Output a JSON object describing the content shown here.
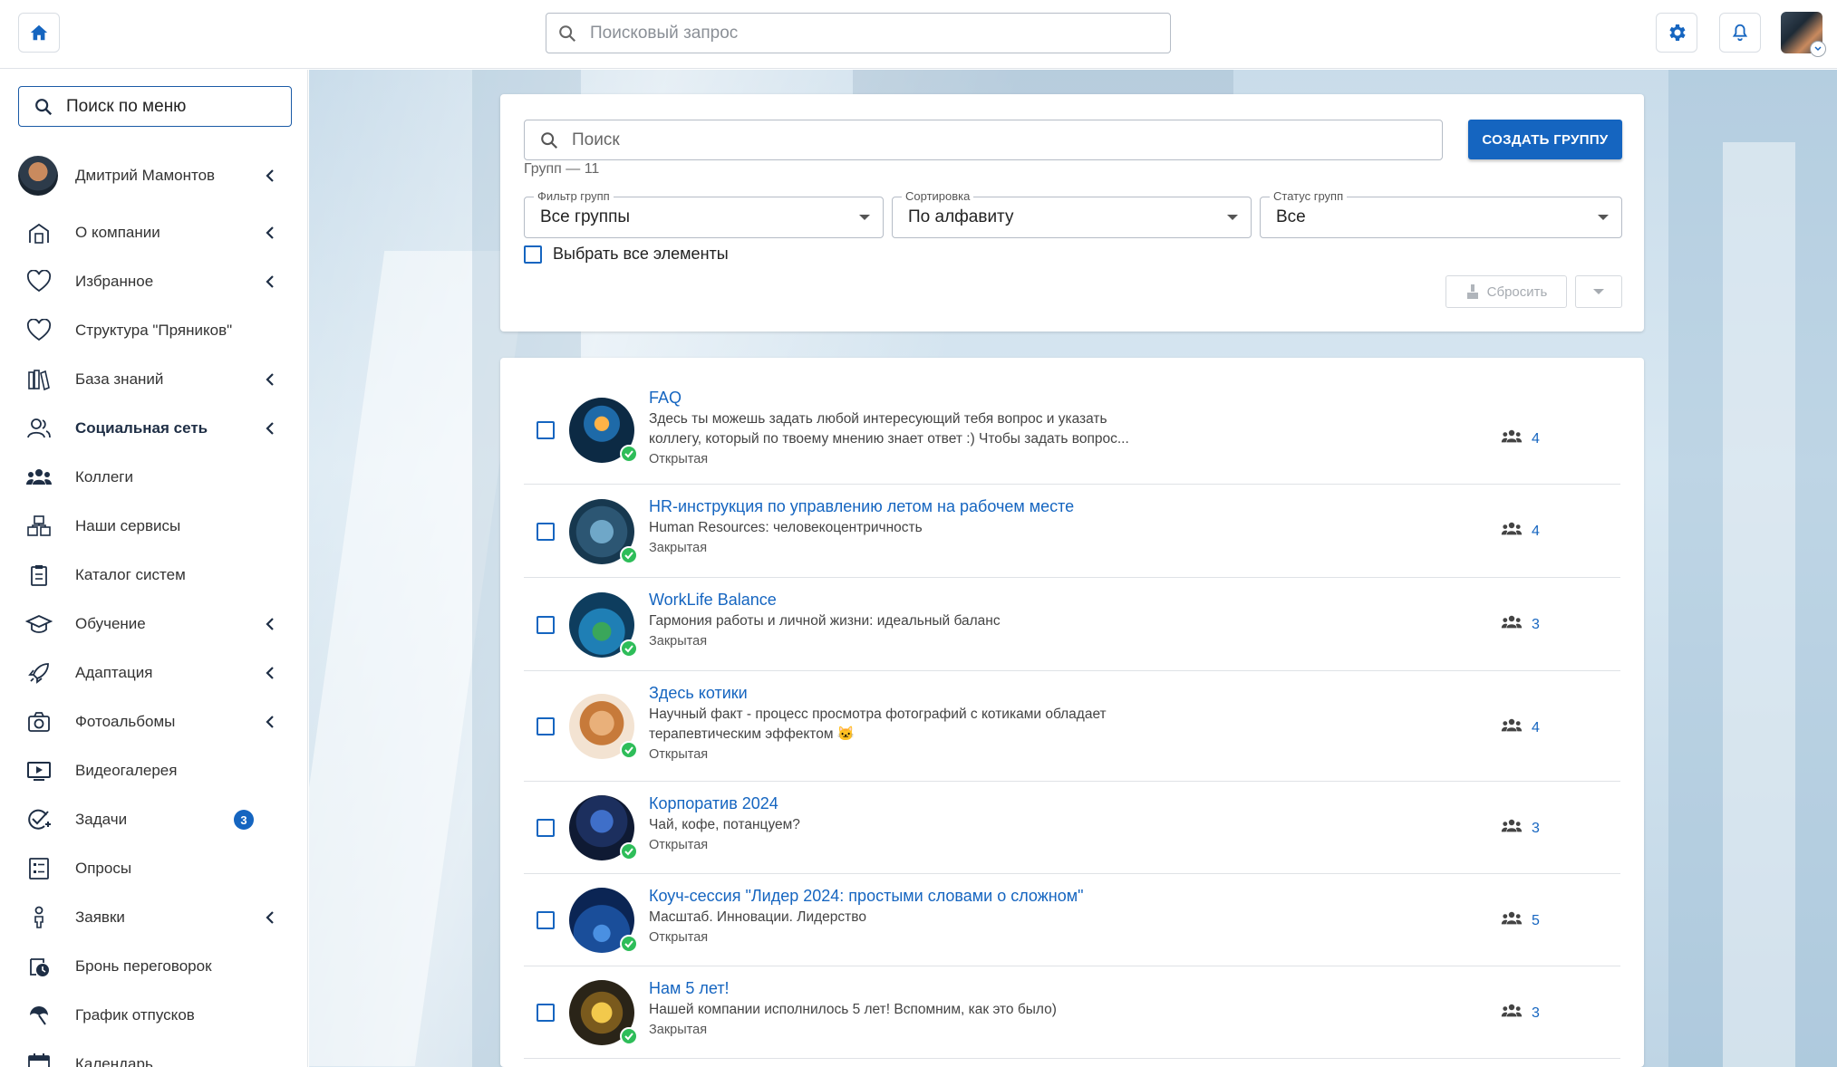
{
  "header": {
    "search_placeholder": "Поисковый запрос",
    "icons": [
      "home-icon",
      "gear-icon",
      "bell-icon"
    ]
  },
  "sidebar": {
    "search_placeholder": "Поиск по меню",
    "user_name": "Дмитрий Мамонтов",
    "items": [
      {
        "label": "О компании",
        "icon": "building-icon",
        "chevron": true
      },
      {
        "label": "Избранное",
        "icon": "heart-icon",
        "chevron": true
      },
      {
        "label": "Структура \"Пряников\"",
        "icon": "heart-icon",
        "chevron": false
      },
      {
        "label": "База знаний",
        "icon": "books-icon",
        "chevron": true
      },
      {
        "label": "Социальная сеть",
        "icon": "users-icon",
        "chevron": true,
        "active": true
      },
      {
        "label": "Коллеги",
        "icon": "group-icon",
        "chevron": false
      },
      {
        "label": "Наши сервисы",
        "icon": "services-icon",
        "chevron": false
      },
      {
        "label": "Каталог систем",
        "icon": "clipboard-icon",
        "chevron": false
      },
      {
        "label": "Обучение",
        "icon": "graduation-cap-icon",
        "chevron": true
      },
      {
        "label": "Адаптация",
        "icon": "rocket-icon",
        "chevron": true
      },
      {
        "label": "Фотоальбомы",
        "icon": "camera-icon",
        "chevron": true
      },
      {
        "label": "Видеогалерея",
        "icon": "video-icon",
        "chevron": false
      },
      {
        "label": "Задачи",
        "icon": "task-check-icon",
        "chevron": false,
        "badge": "3"
      },
      {
        "label": "Опросы",
        "icon": "list-icon",
        "chevron": false
      },
      {
        "label": "Заявки",
        "icon": "person-icon",
        "chevron": true
      },
      {
        "label": "Бронь переговорок",
        "icon": "clock-calendar-icon",
        "chevron": false
      },
      {
        "label": "График отпусков",
        "icon": "umbrella-icon",
        "chevron": false
      },
      {
        "label": "Календарь",
        "icon": "calendar-icon",
        "chevron": false
      }
    ]
  },
  "filters": {
    "search_placeholder": "Поиск",
    "create_button": "СОЗДАТЬ ГРУППУ",
    "group_count": "Групп — 11",
    "filter_label": "Фильтр групп",
    "filter_value": "Все группы",
    "sort_label": "Сортировка",
    "sort_value": "По алфавиту",
    "status_label": "Статус групп",
    "status_value": "Все",
    "select_all": "Выбрать все элементы",
    "reset_button": "Сбросить"
  },
  "groups": [
    {
      "title": "FAQ",
      "desc": "Здесь ты можешь задать любой интересующий тебя вопрос и указать коллегу, который по твоему мнению знает ответ :) Чтобы задать вопрос...",
      "type": "Открытая",
      "members": "4"
    },
    {
      "title": "HR-инструкция по управлению летом на рабочем месте",
      "desc": "Human Resources: человекоцентричность",
      "type": "Закрытая",
      "members": "4"
    },
    {
      "title": "WorkLife Balance",
      "desc": "Гармония работы и личной жизни: идеальный баланс",
      "type": "Закрытая",
      "members": "3"
    },
    {
      "title": "Здесь котики",
      "desc": "Научный факт - процесс просмотра фотографий с котиками обладает терапевтическим эффектом 🐱",
      "type": "Открытая",
      "members": "4"
    },
    {
      "title": "Корпоратив 2024",
      "desc": "Чай, кофе, потанцуем?",
      "type": "Открытая",
      "members": "3"
    },
    {
      "title": "Коуч-сессия \"Лидер 2024: простыми словами о сложном\"",
      "desc": "Масштаб. Инновации. Лидерство",
      "type": "Открытая",
      "members": "5"
    },
    {
      "title": "Нам 5 лет!",
      "desc": "Нашей компании исполнилось 5 лет! Вспомним, как это было)",
      "type": "Закрытая",
      "members": "3"
    }
  ],
  "colors": {
    "accent": "#1565c0",
    "verified": "#2ebd59"
  }
}
